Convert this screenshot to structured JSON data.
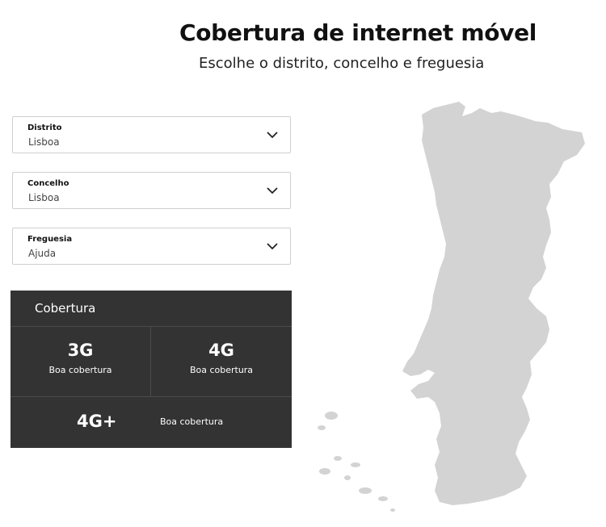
{
  "header": {
    "title": "Cobertura de internet móvel",
    "subtitle": "Escolhe o distrito, concelho e freguesia"
  },
  "filters": {
    "distrito": {
      "label": "Distrito",
      "value": "Lisboa"
    },
    "concelho": {
      "label": "Concelho",
      "value": "Lisboa"
    },
    "freguesia": {
      "label": "Freguesia",
      "value": "Ajuda"
    }
  },
  "coverage": {
    "title": "Cobertura",
    "items": [
      {
        "tech": "3G",
        "status": "Boa cobertura"
      },
      {
        "tech": "4G",
        "status": "Boa cobertura"
      },
      {
        "tech": "4G+",
        "status": "Boa cobertura"
      }
    ]
  },
  "colors": {
    "panel_bg": "#333333",
    "map_fill": "#d3d3d3",
    "border": "#cfcfcf"
  }
}
